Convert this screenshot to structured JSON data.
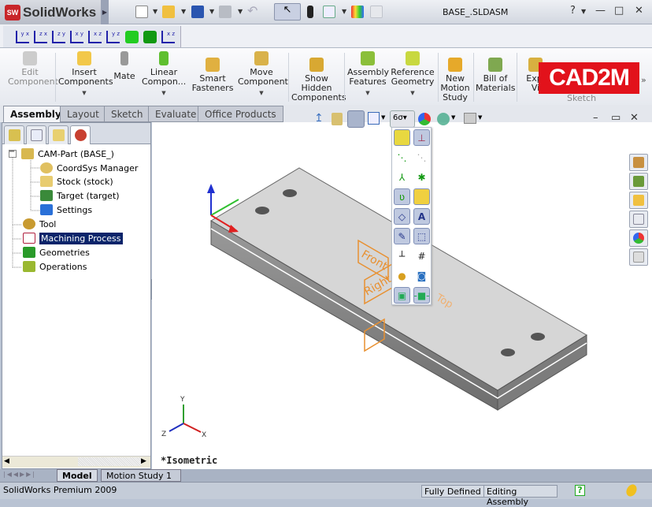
{
  "app": {
    "name": "SolidWorks",
    "logo_text": "SW",
    "document_title": "BASE_.SLDASM"
  },
  "titlebar": {
    "help": "?",
    "minimize": "—",
    "restore": "□",
    "close": "✕"
  },
  "ribbon": {
    "buttons": [
      {
        "label1": "Edit",
        "label2": "Component",
        "disabled": true,
        "icon": "edit-component-icon",
        "color": "#c8c8c8"
      },
      {
        "label1": "Insert",
        "label2": "Components",
        "dropdown": true,
        "icon": "insert-components-icon",
        "color": "#f2c84a"
      },
      {
        "label1": "Mate",
        "label2": "",
        "icon": "mate-paperclip-icon",
        "color": "#8a8a8a"
      },
      {
        "label1": "Linear",
        "label2": "Compon...",
        "dropdown": true,
        "icon": "linear-pattern-icon",
        "color": "#5fbf2f"
      },
      {
        "label1": "Smart",
        "label2": "Fasteners",
        "icon": "smart-fasteners-icon",
        "color": "#e0b040"
      },
      {
        "label1": "Move",
        "label2": "Component",
        "dropdown": true,
        "icon": "move-component-icon",
        "color": "#d9b24a"
      },
      {
        "label1": "Show",
        "label2": "Hidden",
        "label3": "Components",
        "icon": "show-hidden-icon",
        "color": "#d8a832"
      },
      {
        "label1": "Assembly",
        "label2": "Features",
        "dropdown": true,
        "icon": "assembly-features-icon",
        "color": "#8bbf3a"
      },
      {
        "label1": "Reference",
        "label2": "Geometry",
        "dropdown": true,
        "icon": "reference-geometry-icon",
        "color": "#c8d840"
      },
      {
        "label1": "New",
        "label2": "Motion",
        "label3": "Study",
        "icon": "motion-study-icon",
        "color": "#e6a92a"
      },
      {
        "label1": "Bill of",
        "label2": "Materials",
        "icon": "bill-of-materials-icon",
        "color": "#7fa850"
      },
      {
        "label1": "Expl",
        "label2": "Vi",
        "icon": "exploded-view-icon",
        "color": "#d8b040"
      }
    ],
    "sketch_label": "Sketch",
    "more": "»",
    "watermark": "CAD2M"
  },
  "tabs": [
    {
      "label": "Assembly",
      "active": true
    },
    {
      "label": "Layout"
    },
    {
      "label": "Sketch"
    },
    {
      "label": "Evaluate"
    },
    {
      "label": "Office Products"
    }
  ],
  "tree": {
    "root": "CAM-Part (BASE_)",
    "children": [
      "CoordSys Manager",
      "Stock (stock)",
      "Target (target)",
      "Settings"
    ],
    "items": [
      "Tool",
      "Machining Process",
      "Geometries",
      "Operations"
    ],
    "selected": "Machining Process",
    "collapse": "−"
  },
  "viewport": {
    "view_name": "*Isometric",
    "axes": {
      "x": "X",
      "y": "Y",
      "z": "Z"
    },
    "plane_labels": [
      "Front",
      "Right",
      "Top"
    ]
  },
  "bottom_tabs": [
    {
      "label": "Model",
      "active": true
    },
    {
      "label": "Motion Study 1"
    }
  ],
  "status": {
    "product": "SolidWorks Premium 2009",
    "state": "Fully Defined",
    "mode": "Editing Assembly",
    "help": "?"
  }
}
